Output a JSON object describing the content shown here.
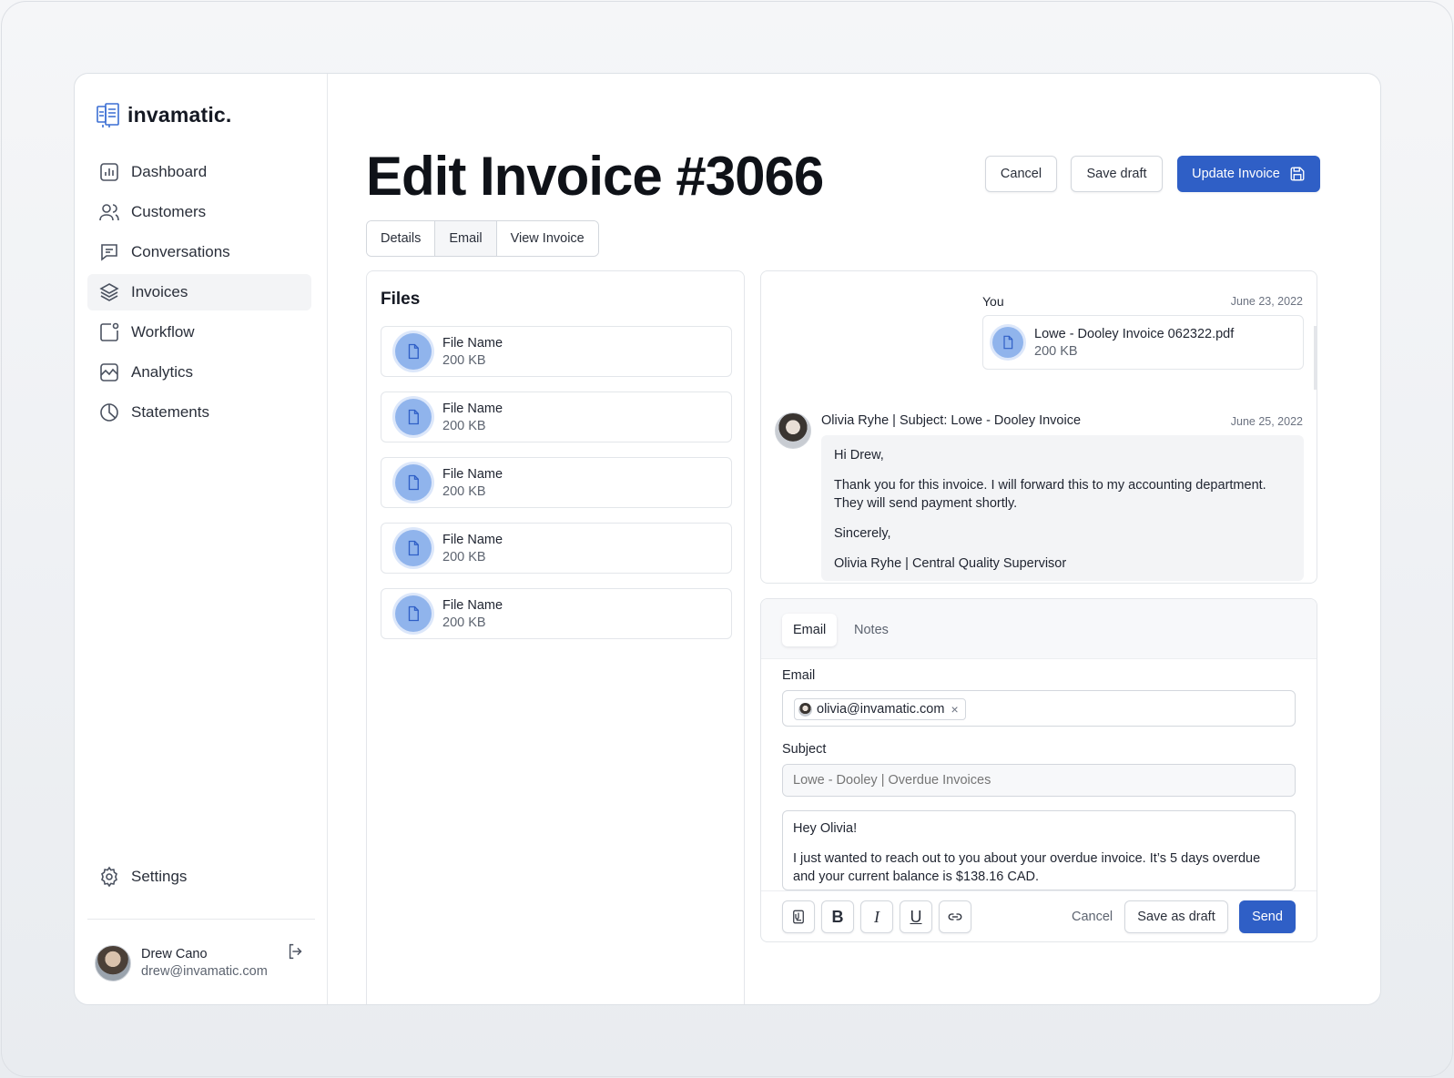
{
  "brand": {
    "name": "invamatic."
  },
  "nav": {
    "items": [
      {
        "label": "Dashboard",
        "icon": "dashboard-icon"
      },
      {
        "label": "Customers",
        "icon": "users-icon"
      },
      {
        "label": "Conversations",
        "icon": "chat-icon"
      },
      {
        "label": "Invoices",
        "icon": "layers-icon",
        "active": true
      },
      {
        "label": "Workflow",
        "icon": "workflow-icon"
      },
      {
        "label": "Analytics",
        "icon": "analytics-icon"
      },
      {
        "label": "Statements",
        "icon": "pie-icon"
      }
    ],
    "settings_label": "Settings"
  },
  "user": {
    "name": "Drew Cano",
    "email": "drew@invamatic.com"
  },
  "header": {
    "title": "Edit Invoice #3066",
    "cancel_label": "Cancel",
    "save_draft_label": "Save draft",
    "update_label": "Update Invoice"
  },
  "tabs": [
    {
      "label": "Details"
    },
    {
      "label": "Email",
      "active": true
    },
    {
      "label": "View Invoice"
    }
  ],
  "files": {
    "title": "Files",
    "items": [
      {
        "name": "File Name",
        "size": "200 KB"
      },
      {
        "name": "File Name",
        "size": "200 KB"
      },
      {
        "name": "File Name",
        "size": "200 KB"
      },
      {
        "name": "File Name",
        "size": "200 KB"
      },
      {
        "name": "File Name",
        "size": "200 KB"
      }
    ]
  },
  "thread": {
    "sent": {
      "sender": "You",
      "date": "June 23, 2022",
      "attachment_name": "Lowe - Dooley Invoice 062322.pdf",
      "attachment_size": "200 KB"
    },
    "reply": {
      "header": "Olivia Ryhe | Subject: Lowe - Dooley Invoice",
      "date": "June 25, 2022",
      "greeting": "Hi Drew,",
      "body": "Thank you for this invoice. I will forward this to my accounting department. They will send payment shortly.",
      "closing": "Sincerely,",
      "signature": "Olivia Ryhe | Central Quality Supervisor"
    }
  },
  "compose": {
    "tabs": [
      {
        "label": "Email",
        "active": true
      },
      {
        "label": "Notes"
      }
    ],
    "email_label": "Email",
    "recipient": "olivia@invamatic.com",
    "subject_label": "Subject",
    "subject_placeholder": "Lowe - Dooley | Overdue Invoices",
    "body_greeting": "Hey Olivia!",
    "body_text": "I just wanted to reach out to you about your overdue invoice. It’s 5 days overdue and your current balance is $138.16 CAD.",
    "bold_glyph": "B",
    "italic_glyph": "I",
    "underline_glyph": "U",
    "cancel_label": "Cancel",
    "save_draft_label": "Save as draft",
    "send_label": "Send"
  },
  "colors": {
    "primary": "#2f5fc6",
    "file_icon": "#90b4ec"
  }
}
